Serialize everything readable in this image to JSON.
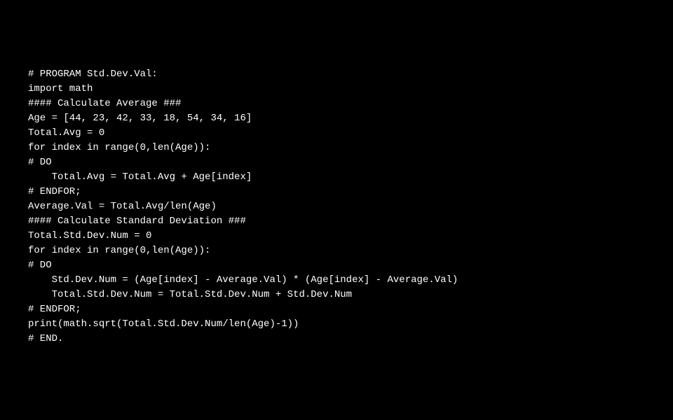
{
  "code": {
    "lines": [
      "# PROGRAM Std.Dev.Val:",
      "import math",
      "",
      "#### Calculate Average ###",
      "Age = [44, 23, 42, 33, 18, 54, 34, 16]",
      "Total.Avg = 0",
      "for index in range(0,len(Age)):",
      "# DO",
      "    Total.Avg = Total.Avg + Age[index]",
      "# ENDFOR;",
      "",
      "Average.Val = Total.Avg/len(Age)",
      "",
      "#### Calculate Standard Deviation ###",
      "Total.Std.Dev.Num = 0",
      "for index in range(0,len(Age)):",
      "# DO",
      "    Std.Dev.Num = (Age[index] - Average.Val) * (Age[index] - Average.Val)",
      "    Total.Std.Dev.Num = Total.Std.Dev.Num + Std.Dev.Num",
      "# ENDFOR;",
      "print(math.sqrt(Total.Std.Dev.Num/len(Age)-1))",
      "# END."
    ]
  }
}
